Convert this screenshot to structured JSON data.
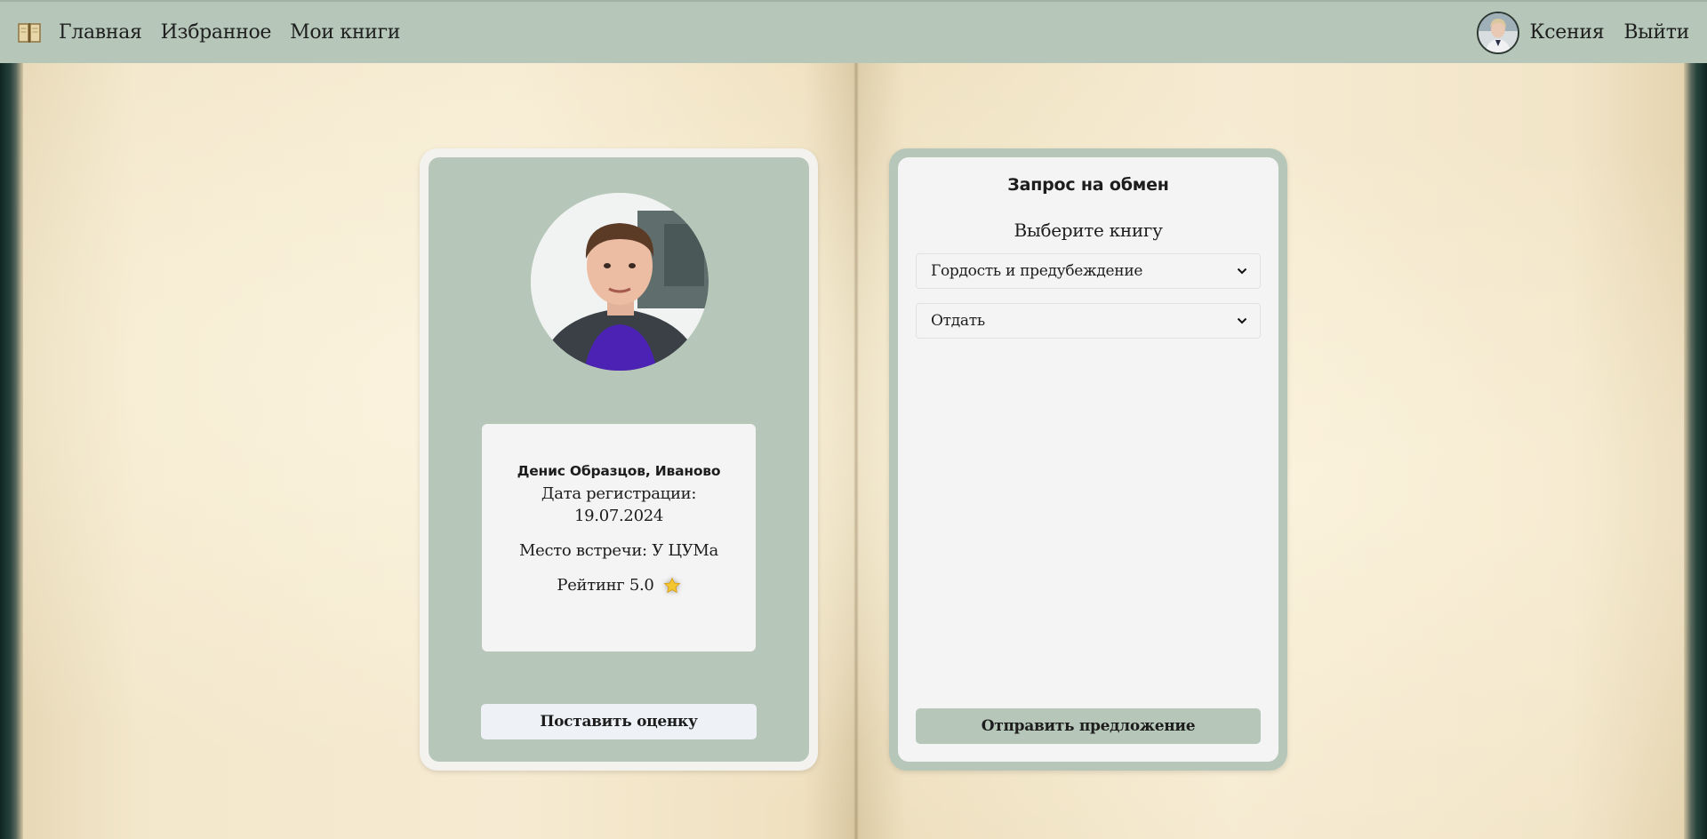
{
  "nav": {
    "logo_icon": "open-book-icon",
    "links": [
      "Главная",
      "Избранное",
      "Мои книги"
    ],
    "username": "Ксения",
    "logout": "Выйти"
  },
  "profile": {
    "name_city": "Денис Образцов, Иваново",
    "registration_label": "Дата регистрации:",
    "registration_date": "19.07.2024",
    "meeting_place": "Место встречи: У ЦУМа",
    "rating": "Рейтинг 5.0",
    "rating_icon": "star-icon",
    "rate_button": "Поставить оценку"
  },
  "exchange": {
    "title": "Запрос на обмен",
    "choose_label": "Выберите книгу",
    "book_select": "Гордость и предубеждение",
    "type_select": "Отдать",
    "send_button": "Отправить предложение"
  },
  "colors": {
    "accent": "#b6c7ba",
    "card": "#f4f4f4",
    "page": "#f3e7cb"
  }
}
